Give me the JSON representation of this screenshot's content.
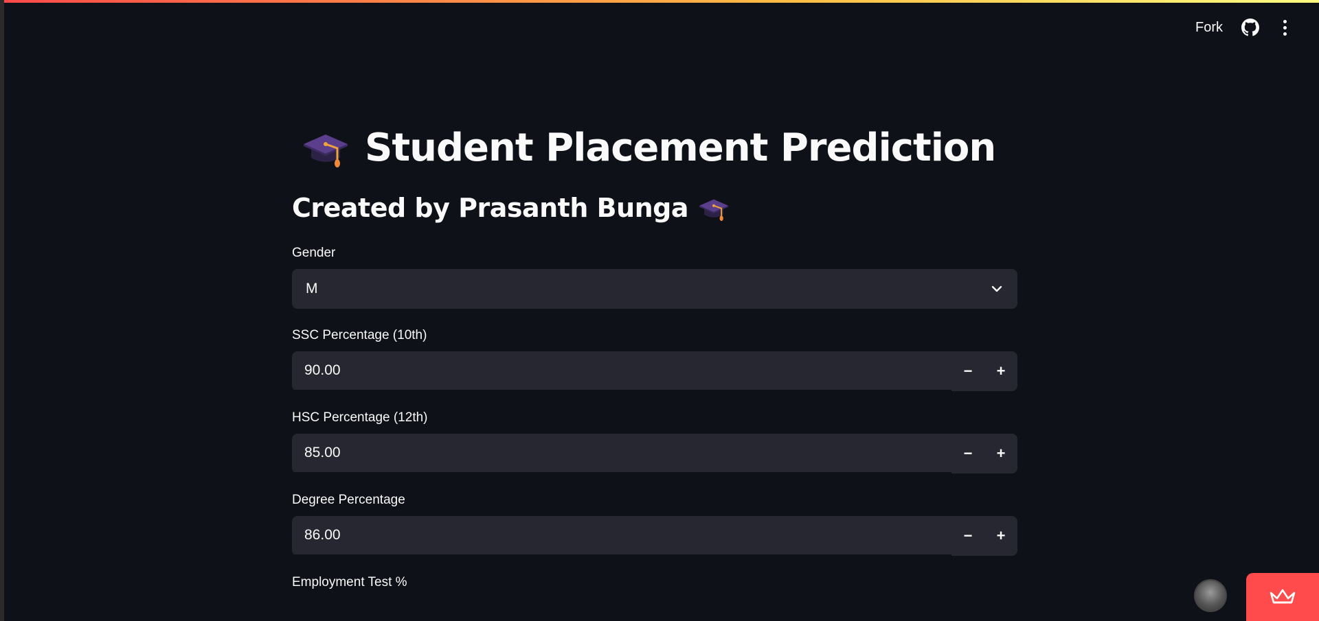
{
  "header": {
    "fork_label": "Fork",
    "icons": [
      "github-icon",
      "more-vertical-icon"
    ]
  },
  "page": {
    "title": "Student Placement Prediction",
    "title_icon": "graduation-cap-icon",
    "subtitle": "Created by Prasanth Bunga",
    "subtitle_icon": "graduation-cap-icon"
  },
  "form": {
    "gender": {
      "label": "Gender",
      "value": "M"
    },
    "ssc": {
      "label": "SSC Percentage (10th)",
      "value": "90.00"
    },
    "hsc": {
      "label": "HSC Percentage (12th)",
      "value": "85.00"
    },
    "degree": {
      "label": "Degree Percentage",
      "value": "86.00"
    },
    "employment": {
      "label": "Employment Test %"
    },
    "stepper": {
      "minus": "−",
      "plus": "+"
    }
  },
  "colors": {
    "background": "#0e1117",
    "input_bg": "#262730",
    "accent": "#ff4b4b",
    "text": "#fafafa"
  }
}
